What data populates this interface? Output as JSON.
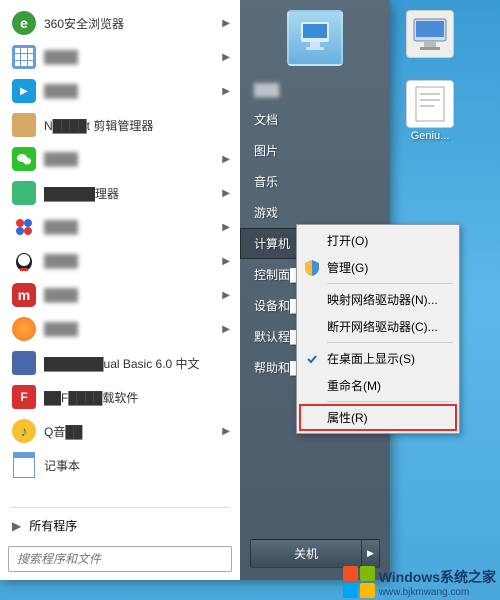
{
  "desktop": {
    "icon1_label": "Geniu..."
  },
  "start": {
    "programs": [
      {
        "label": "360安全浏览器",
        "icon": "ie-360",
        "arrow": true
      },
      {
        "label": "████",
        "icon": "calc",
        "arrow": true,
        "blur": true
      },
      {
        "label": "████",
        "icon": "tencent",
        "arrow": true,
        "blur": true
      },
      {
        "label": "N████t 剪辑管理器",
        "icon": "clip",
        "arrow": false,
        "partial": true
      },
      {
        "label": "████",
        "icon": "wechat",
        "arrow": true,
        "blur": true
      },
      {
        "label": "██████理器",
        "icon": "manager",
        "arrow": true,
        "partial": true
      },
      {
        "label": "████",
        "icon": "baidu",
        "arrow": true,
        "blur": true
      },
      {
        "label": "████",
        "icon": "qq",
        "arrow": true,
        "blur": true
      },
      {
        "label": "████",
        "icon": "ximalaya",
        "arrow": true,
        "blur": true
      },
      {
        "label": "████",
        "icon": "orange",
        "arrow": true,
        "blur": true
      },
      {
        "label": "███████ual Basic 6.0 中文",
        "icon": "vb",
        "arrow": false,
        "partial": true
      },
      {
        "label": "██F████载软件",
        "icon": "flash",
        "arrow": false,
        "partial": true
      },
      {
        "label": "Q音██",
        "icon": "qqmusic",
        "arrow": true,
        "partial": true
      },
      {
        "label": "记事本",
        "icon": "notepad",
        "arrow": false
      }
    ],
    "all_programs": "所有程序",
    "search_placeholder": "搜索程序和文件"
  },
  "right": {
    "items": [
      {
        "label": "███",
        "blur": true
      },
      {
        "label": "文档"
      },
      {
        "label": "图片"
      },
      {
        "label": "音乐"
      },
      {
        "label": "游戏"
      },
      {
        "label": "计算机",
        "selected": true
      },
      {
        "label": "控制面█",
        "partial": true
      },
      {
        "label": "设备和█",
        "partial": true
      },
      {
        "label": "默认程█",
        "partial": true
      },
      {
        "label": "帮助和█",
        "partial": true
      }
    ],
    "shutdown": "关机"
  },
  "context": {
    "items": [
      {
        "label": "打开(O)"
      },
      {
        "label": "管理(G)",
        "icon": "shield"
      },
      {
        "sep": true
      },
      {
        "label": "映射网络驱动器(N)..."
      },
      {
        "label": "断开网络驱动器(C)..."
      },
      {
        "sep": true
      },
      {
        "label": "在桌面上显示(S)",
        "icon": "check"
      },
      {
        "label": "重命名(M)"
      },
      {
        "sep": true
      },
      {
        "label": "属性(R)",
        "highlight": true
      }
    ]
  },
  "watermark": {
    "text": "Windows系统之家",
    "sub": "www.bjkmwang.com"
  },
  "colors": {
    "ie360": "#3c9c3c",
    "calc": "#6a9ed8",
    "tencent": "#1a9cdc",
    "clip": "#d8a868",
    "wechat": "#2dc12d",
    "manager": "#3cb878",
    "baidu": "#e03838",
    "qq": "#f8c848",
    "ximalaya": "#d03030",
    "orange": "#f87828",
    "vb": "#4868a8",
    "flash": "#d83030",
    "qqmusic": "#f8c030",
    "notepad": "#6a9ed8"
  }
}
